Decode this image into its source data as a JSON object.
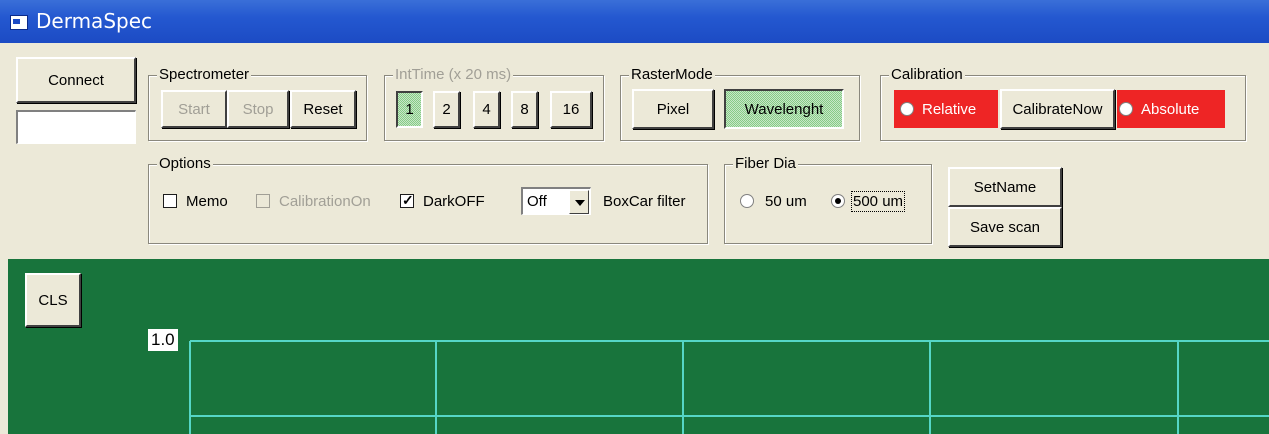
{
  "window": {
    "title": "DermaSpec"
  },
  "connect": {
    "label": "Connect",
    "value": ""
  },
  "spectrometer": {
    "legend": "Spectrometer",
    "start": "Start",
    "stop": "Stop",
    "reset": "Reset"
  },
  "inttime": {
    "legend": "IntTime (x 20 ms)",
    "options": [
      "1",
      "2",
      "4",
      "8",
      "16"
    ],
    "selected": "1"
  },
  "rastermode": {
    "legend": "RasterMode",
    "pixel": "Pixel",
    "wavelength": "Wavelenght",
    "selected": "Wavelenght"
  },
  "calibration": {
    "legend": "Calibration",
    "relative": "Relative",
    "calibrate_now": "CalibrateNow",
    "absolute": "Absolute",
    "color": "#ee2525"
  },
  "options": {
    "legend": "Options",
    "memo": "Memo",
    "calibration_on": "CalibrationOn",
    "dark_off": "DarkOFF",
    "boxcar_value": "Off",
    "boxcar_label": "BoxCar filter"
  },
  "fiber": {
    "legend": "Fiber Dia",
    "opt_50": "50 um",
    "opt_500": "500 um",
    "selected": "500 um"
  },
  "actions": {
    "set_name": "SetName",
    "save_scan": "Save scan"
  },
  "plot": {
    "cls": "CLS",
    "y_top_label": "1.0",
    "background": "#18743c",
    "grid_color": "#55d6c6"
  }
}
